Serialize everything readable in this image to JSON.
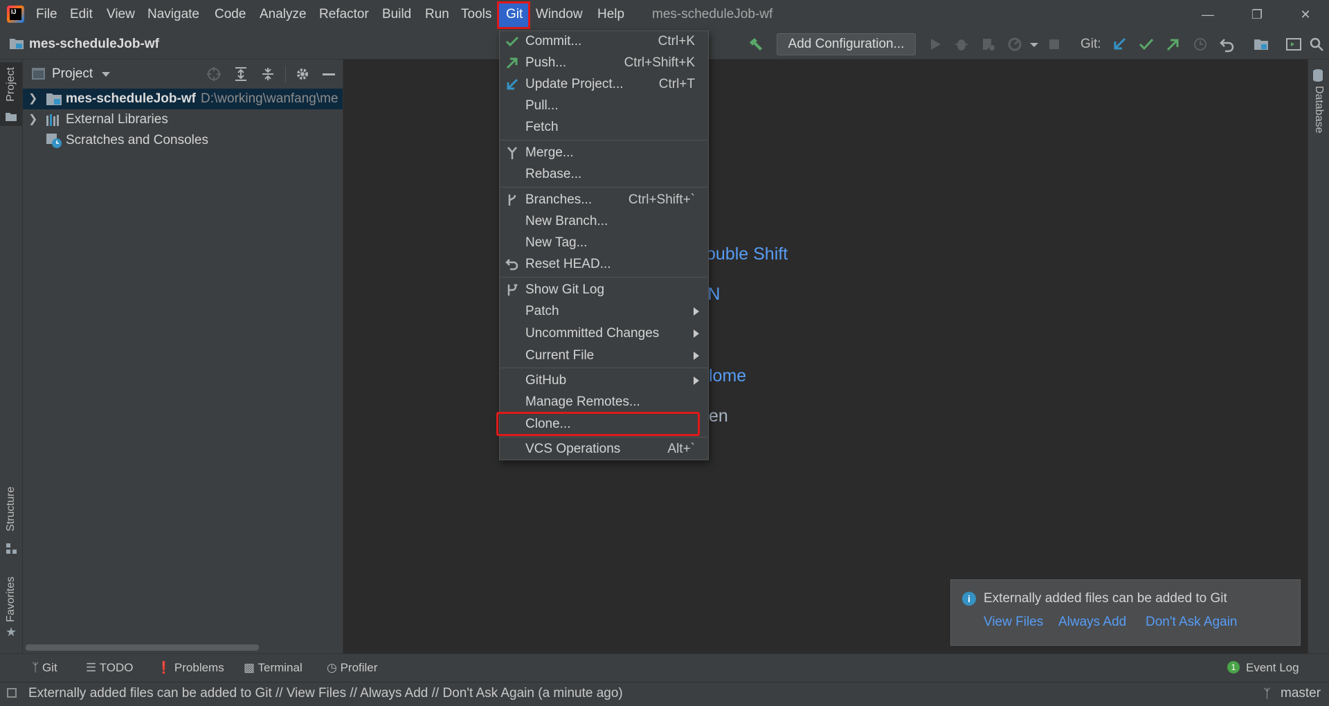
{
  "menubar": {
    "items": [
      {
        "id": "file",
        "label": "File"
      },
      {
        "id": "edit",
        "label": "Edit"
      },
      {
        "id": "view",
        "label": "View"
      },
      {
        "id": "navigate",
        "label": "Navigate"
      },
      {
        "id": "code",
        "label": "Code"
      },
      {
        "id": "analyze",
        "label": "Analyze"
      },
      {
        "id": "refactor",
        "label": "Refactor"
      },
      {
        "id": "build",
        "label": "Build"
      },
      {
        "id": "run",
        "label": "Run"
      },
      {
        "id": "tools",
        "label": "Tools"
      },
      {
        "id": "git",
        "label": "Git"
      },
      {
        "id": "window",
        "label": "Window"
      },
      {
        "id": "help",
        "label": "Help"
      }
    ]
  },
  "window": {
    "title": "mes-scheduleJob-wf"
  },
  "navbar": {
    "project": "mes-scheduleJob-wf",
    "add_configuration": "Add Configuration...",
    "git_label": "Git:"
  },
  "left_strip": {
    "project": "Project",
    "structure": "Structure",
    "favorites": "Favorites"
  },
  "right_strip": {
    "database": "Database"
  },
  "project_panel": {
    "title": "Project",
    "tree": [
      {
        "name": "mes-scheduleJob-wf",
        "path": "D:\\working\\wanfang\\me"
      },
      {
        "name": "External Libraries"
      },
      {
        "name": "Scratches and Consoles"
      }
    ]
  },
  "editor_hints": [
    "ouble Shift",
    "-N",
    "lome",
    "en"
  ],
  "git_menu": {
    "items": [
      {
        "label": "Commit...",
        "shortcut": "Ctrl+K",
        "icon": "check-icon"
      },
      {
        "label": "Push...",
        "shortcut": "Ctrl+Shift+K",
        "icon": "push-arrow-icon"
      },
      {
        "label": "Update Project...",
        "shortcut": "Ctrl+T",
        "icon": "update-arrow-icon"
      },
      {
        "label": "Pull..."
      },
      {
        "label": "Fetch"
      },
      {
        "label": "Merge...",
        "icon": "merge-icon"
      },
      {
        "label": "Rebase..."
      },
      {
        "label": "Branches...",
        "shortcut": "Ctrl+Shift+`",
        "icon": "branch-icon"
      },
      {
        "label": "New Branch..."
      },
      {
        "label": "New Tag..."
      },
      {
        "label": "Reset HEAD...",
        "icon": "undo-icon"
      },
      {
        "label": "Show Git Log",
        "icon": "git-log-icon"
      },
      {
        "label": "Patch"
      },
      {
        "label": "Uncommitted Changes"
      },
      {
        "label": "Current File"
      },
      {
        "label": "GitHub"
      },
      {
        "label": "Manage Remotes..."
      },
      {
        "label": "Clone..."
      },
      {
        "label": "VCS Operations",
        "shortcut": "Alt+`"
      }
    ]
  },
  "notification": {
    "text": "Externally added files can be added to Git",
    "links": [
      "View Files",
      "Always Add",
      "Don't Ask Again"
    ]
  },
  "bottom_tools": [
    "Git",
    "TODO",
    "Problems",
    "Terminal",
    "Profiler",
    "Event Log"
  ],
  "event_count": "1",
  "status": {
    "text": "Externally added files can be added to Git // View Files // Always Add // Don't Ask Again (a minute ago)",
    "branch": "master"
  },
  "colors": {
    "accent": "#589df6",
    "highlight": "#e0191a",
    "selection": "#2f65ca"
  }
}
